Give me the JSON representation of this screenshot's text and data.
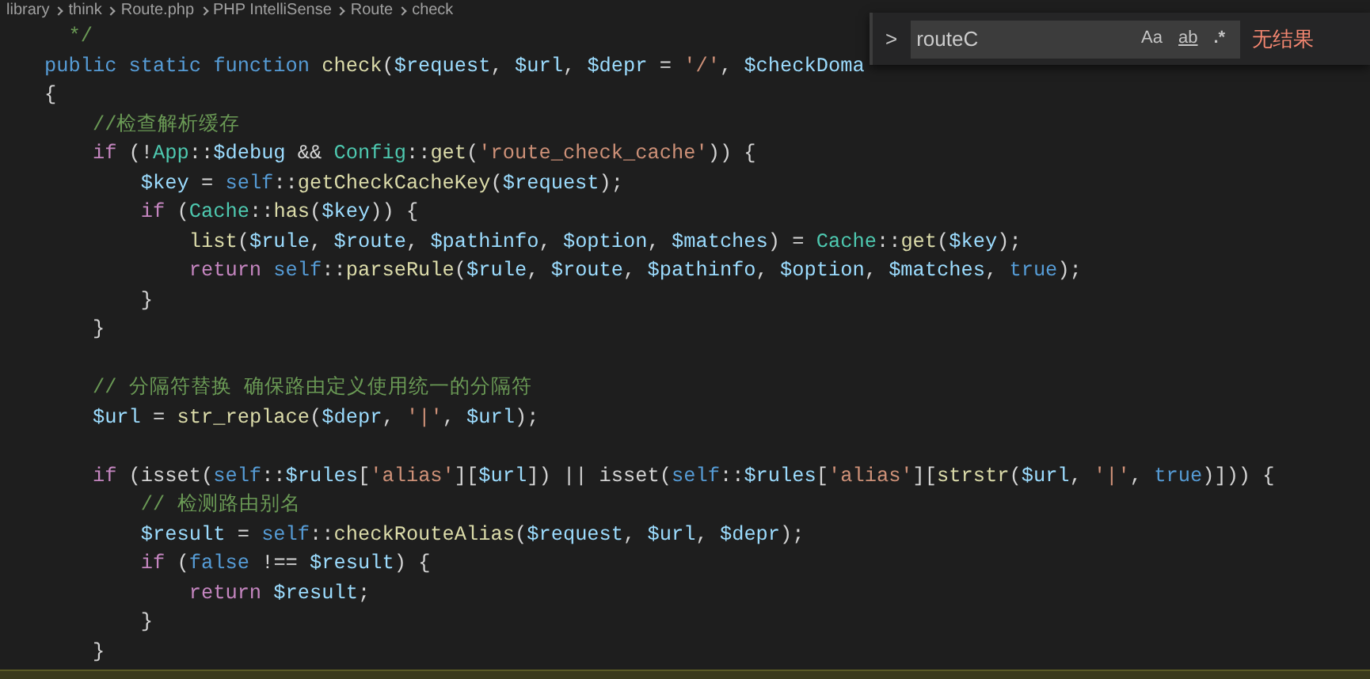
{
  "breadcrumb": [
    "library",
    "think",
    "Route.php",
    "PHP IntelliSense",
    "Route",
    "check"
  ],
  "code_lines": [
    {
      "tokens": [
        {
          "text": "  */",
          "kind": "comment"
        }
      ]
    },
    {
      "tokens": [
        {
          "text": "public static function ",
          "kind": "keyword"
        },
        {
          "text": "check",
          "kind": "function"
        },
        {
          "text": "(",
          "kind": "plain"
        },
        {
          "text": "$request",
          "kind": "variable"
        },
        {
          "text": ", ",
          "kind": "plain"
        },
        {
          "text": "$url",
          "kind": "variable"
        },
        {
          "text": ", ",
          "kind": "plain"
        },
        {
          "text": "$depr",
          "kind": "variable"
        },
        {
          "text": " = ",
          "kind": "plain"
        },
        {
          "text": "'/'",
          "kind": "string"
        },
        {
          "text": ", ",
          "kind": "plain"
        },
        {
          "text": "$checkDoma",
          "kind": "variable"
        }
      ]
    },
    {
      "tokens": [
        {
          "text": "{",
          "kind": "plain"
        }
      ]
    },
    {
      "tokens": [
        {
          "text": "    //检查解析缓存",
          "kind": "comment"
        }
      ]
    },
    {
      "tokens": [
        {
          "text": "    if ",
          "kind": "control"
        },
        {
          "text": "(!",
          "kind": "plain"
        },
        {
          "text": "App",
          "kind": "class"
        },
        {
          "text": "::",
          "kind": "plain"
        },
        {
          "text": "$debug",
          "kind": "variable"
        },
        {
          "text": " && ",
          "kind": "plain"
        },
        {
          "text": "Config",
          "kind": "class"
        },
        {
          "text": "::",
          "kind": "plain"
        },
        {
          "text": "get",
          "kind": "function"
        },
        {
          "text": "(",
          "kind": "plain"
        },
        {
          "text": "'route_check_cache'",
          "kind": "string"
        },
        {
          "text": ")) {",
          "kind": "plain"
        }
      ]
    },
    {
      "tokens": [
        {
          "text": "        $key",
          "kind": "variable"
        },
        {
          "text": " = ",
          "kind": "plain"
        },
        {
          "text": "self",
          "kind": "keyword"
        },
        {
          "text": "::",
          "kind": "plain"
        },
        {
          "text": "getCheckCacheKey",
          "kind": "function"
        },
        {
          "text": "(",
          "kind": "plain"
        },
        {
          "text": "$request",
          "kind": "variable"
        },
        {
          "text": ");",
          "kind": "plain"
        }
      ]
    },
    {
      "tokens": [
        {
          "text": "        if ",
          "kind": "control"
        },
        {
          "text": "(",
          "kind": "plain"
        },
        {
          "text": "Cache",
          "kind": "class"
        },
        {
          "text": "::",
          "kind": "plain"
        },
        {
          "text": "has",
          "kind": "function"
        },
        {
          "text": "(",
          "kind": "plain"
        },
        {
          "text": "$key",
          "kind": "variable"
        },
        {
          "text": ")) {",
          "kind": "plain"
        }
      ]
    },
    {
      "tokens": [
        {
          "text": "            list",
          "kind": "function"
        },
        {
          "text": "(",
          "kind": "plain"
        },
        {
          "text": "$rule",
          "kind": "variable"
        },
        {
          "text": ", ",
          "kind": "plain"
        },
        {
          "text": "$route",
          "kind": "variable"
        },
        {
          "text": ", ",
          "kind": "plain"
        },
        {
          "text": "$pathinfo",
          "kind": "variable"
        },
        {
          "text": ", ",
          "kind": "plain"
        },
        {
          "text": "$option",
          "kind": "variable"
        },
        {
          "text": ", ",
          "kind": "plain"
        },
        {
          "text": "$matches",
          "kind": "variable"
        },
        {
          "text": ") = ",
          "kind": "plain"
        },
        {
          "text": "Cache",
          "kind": "class"
        },
        {
          "text": "::",
          "kind": "plain"
        },
        {
          "text": "get",
          "kind": "function"
        },
        {
          "text": "(",
          "kind": "plain"
        },
        {
          "text": "$key",
          "kind": "variable"
        },
        {
          "text": ");",
          "kind": "plain"
        }
      ]
    },
    {
      "tokens": [
        {
          "text": "            return ",
          "kind": "control"
        },
        {
          "text": "self",
          "kind": "keyword"
        },
        {
          "text": "::",
          "kind": "plain"
        },
        {
          "text": "parseRule",
          "kind": "function"
        },
        {
          "text": "(",
          "kind": "plain"
        },
        {
          "text": "$rule",
          "kind": "variable"
        },
        {
          "text": ", ",
          "kind": "plain"
        },
        {
          "text": "$route",
          "kind": "variable"
        },
        {
          "text": ", ",
          "kind": "plain"
        },
        {
          "text": "$pathinfo",
          "kind": "variable"
        },
        {
          "text": ", ",
          "kind": "plain"
        },
        {
          "text": "$option",
          "kind": "variable"
        },
        {
          "text": ", ",
          "kind": "plain"
        },
        {
          "text": "$matches",
          "kind": "variable"
        },
        {
          "text": ", ",
          "kind": "plain"
        },
        {
          "text": "true",
          "kind": "keyword"
        },
        {
          "text": ");",
          "kind": "plain"
        }
      ]
    },
    {
      "tokens": [
        {
          "text": "        }",
          "kind": "plain"
        }
      ]
    },
    {
      "tokens": [
        {
          "text": "    }",
          "kind": "plain"
        }
      ]
    },
    {
      "kind": "blank"
    },
    {
      "tokens": [
        {
          "text": "    // 分隔符替换 确保路由定义使用统一的分隔符",
          "kind": "comment"
        }
      ]
    },
    {
      "tokens": [
        {
          "text": "    $url",
          "kind": "variable"
        },
        {
          "text": " = ",
          "kind": "plain"
        },
        {
          "text": "str_replace",
          "kind": "function"
        },
        {
          "text": "(",
          "kind": "plain"
        },
        {
          "text": "$depr",
          "kind": "variable"
        },
        {
          "text": ", ",
          "kind": "plain"
        },
        {
          "text": "'|'",
          "kind": "string"
        },
        {
          "text": ", ",
          "kind": "plain"
        },
        {
          "text": "$url",
          "kind": "variable"
        },
        {
          "text": ");",
          "kind": "plain"
        }
      ]
    },
    {
      "kind": "blank"
    },
    {
      "tokens": [
        {
          "text": "    if ",
          "kind": "control"
        },
        {
          "text": "(isset(",
          "kind": "plain"
        },
        {
          "text": "self",
          "kind": "keyword"
        },
        {
          "text": "::",
          "kind": "plain"
        },
        {
          "text": "$rules",
          "kind": "variable"
        },
        {
          "text": "[",
          "kind": "plain"
        },
        {
          "text": "'alias'",
          "kind": "string"
        },
        {
          "text": "][",
          "kind": "plain"
        },
        {
          "text": "$url",
          "kind": "variable"
        },
        {
          "text": "]) || isset(",
          "kind": "plain"
        },
        {
          "text": "self",
          "kind": "keyword"
        },
        {
          "text": "::",
          "kind": "plain"
        },
        {
          "text": "$rules",
          "kind": "variable"
        },
        {
          "text": "[",
          "kind": "plain"
        },
        {
          "text": "'alias'",
          "kind": "string"
        },
        {
          "text": "][",
          "kind": "plain"
        },
        {
          "text": "strstr",
          "kind": "function"
        },
        {
          "text": "(",
          "kind": "plain"
        },
        {
          "text": "$url",
          "kind": "variable"
        },
        {
          "text": ", ",
          "kind": "plain"
        },
        {
          "text": "'|'",
          "kind": "string"
        },
        {
          "text": ", ",
          "kind": "plain"
        },
        {
          "text": "true",
          "kind": "keyword"
        },
        {
          "text": ")])) {",
          "kind": "plain"
        }
      ]
    },
    {
      "tokens": [
        {
          "text": "        // 检测路由别名",
          "kind": "comment"
        }
      ]
    },
    {
      "tokens": [
        {
          "text": "        $result",
          "kind": "variable"
        },
        {
          "text": " = ",
          "kind": "plain"
        },
        {
          "text": "self",
          "kind": "keyword"
        },
        {
          "text": "::",
          "kind": "plain"
        },
        {
          "text": "checkRouteAlias",
          "kind": "function"
        },
        {
          "text": "(",
          "kind": "plain"
        },
        {
          "text": "$request",
          "kind": "variable"
        },
        {
          "text": ", ",
          "kind": "plain"
        },
        {
          "text": "$url",
          "kind": "variable"
        },
        {
          "text": ", ",
          "kind": "plain"
        },
        {
          "text": "$depr",
          "kind": "variable"
        },
        {
          "text": ");",
          "kind": "plain"
        }
      ]
    },
    {
      "tokens": [
        {
          "text": "        if ",
          "kind": "control"
        },
        {
          "text": "(",
          "kind": "plain"
        },
        {
          "text": "false",
          "kind": "keyword"
        },
        {
          "text": " !== ",
          "kind": "plain"
        },
        {
          "text": "$result",
          "kind": "variable"
        },
        {
          "text": ") {",
          "kind": "plain"
        }
      ]
    },
    {
      "tokens": [
        {
          "text": "            return ",
          "kind": "control"
        },
        {
          "text": "$result",
          "kind": "variable"
        },
        {
          "text": ";",
          "kind": "plain"
        }
      ]
    },
    {
      "tokens": [
        {
          "text": "        }",
          "kind": "plain"
        }
      ]
    },
    {
      "tokens": [
        {
          "text": "    }",
          "kind": "plain"
        }
      ]
    }
  ],
  "find": {
    "toggle": ">",
    "value": "routeC",
    "options": [
      {
        "label": "Aa",
        "selected": false
      },
      {
        "label": "ab",
        "selected": false
      },
      {
        "label": ".*",
        "selected": false
      }
    ],
    "result": "无结果"
  }
}
